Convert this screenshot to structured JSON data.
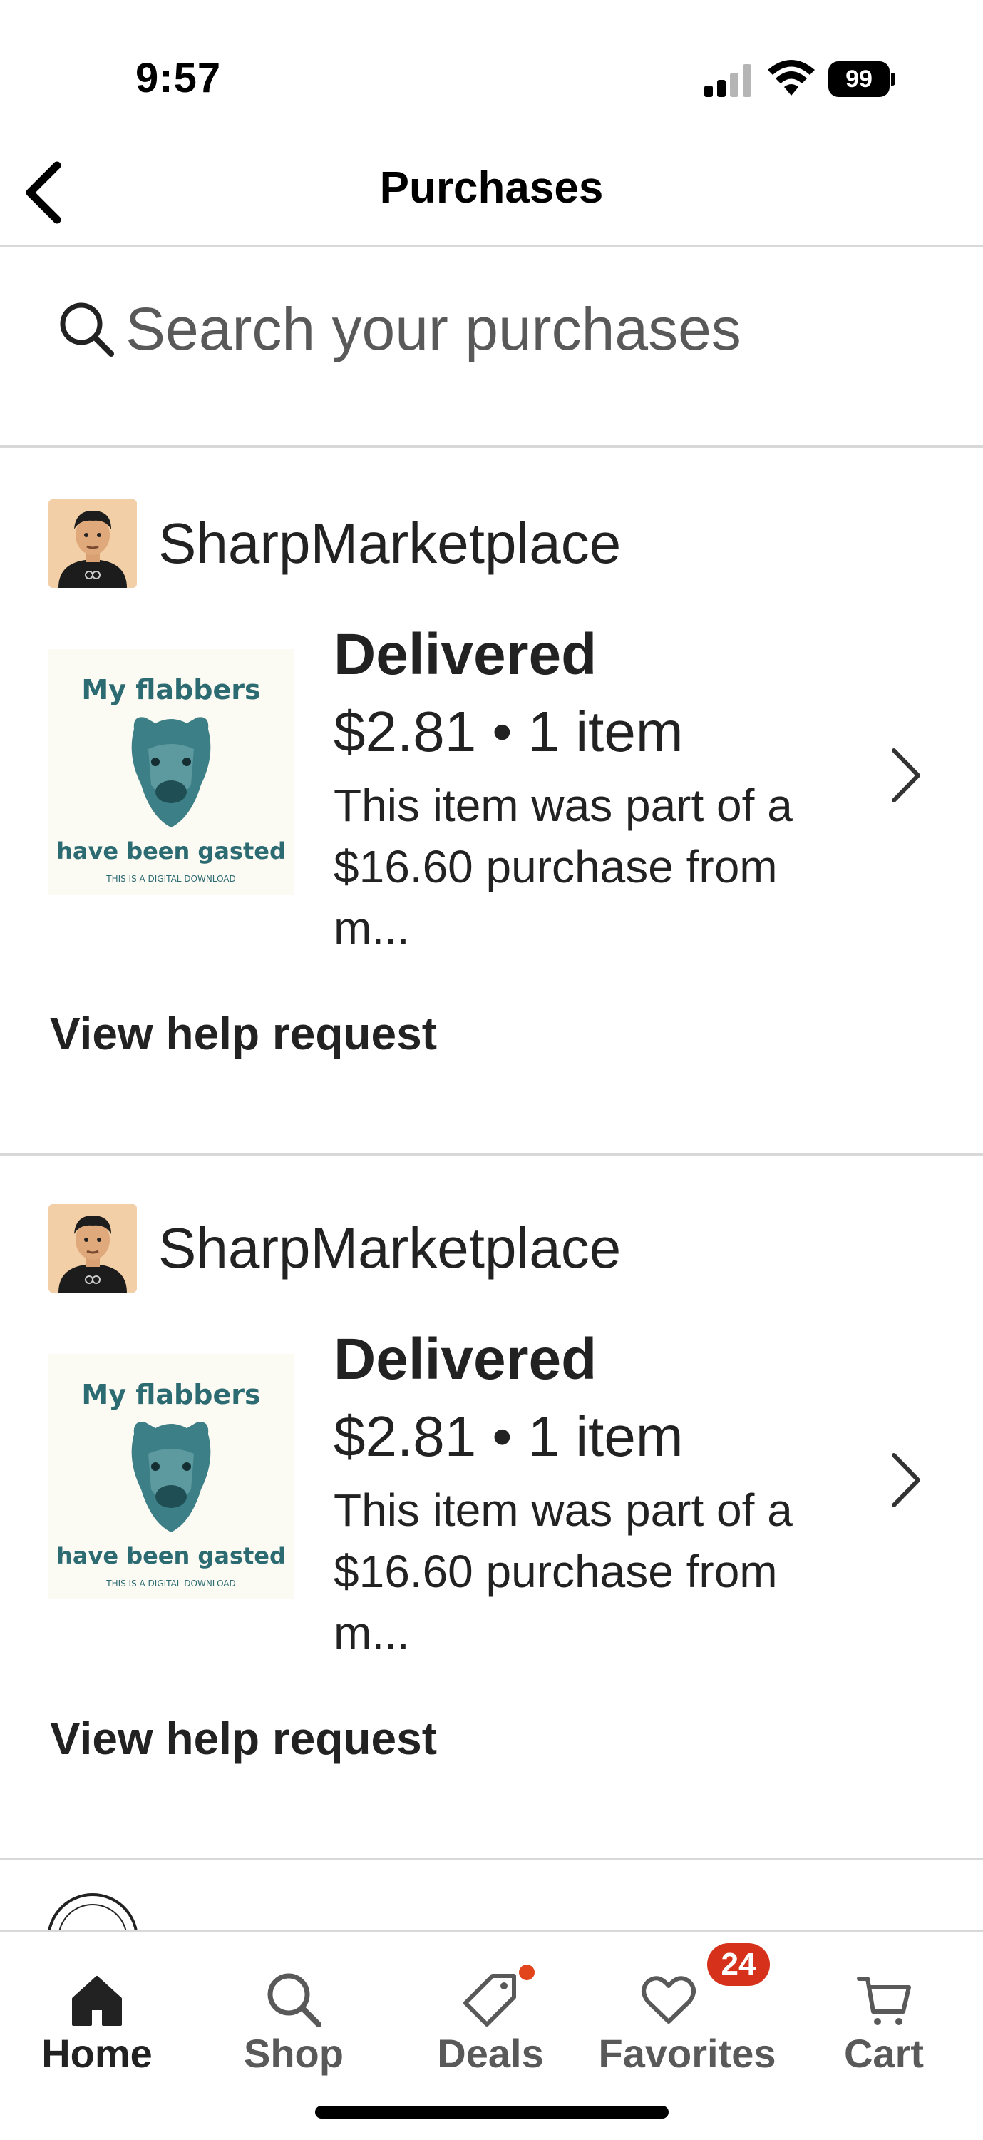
{
  "status_bar": {
    "time": "9:57",
    "battery": "99",
    "icons": [
      "signal-icon",
      "wifi-icon",
      "battery-icon"
    ]
  },
  "header": {
    "title": "Purchases",
    "back_icon": "chevron-left-icon"
  },
  "search": {
    "placeholder": "Search your purchases",
    "value": "",
    "icon": "search-icon"
  },
  "purchases": [
    {
      "shop_name": "SharpMarketplace",
      "status": "Delivered",
      "price_summary": "$2.81 • 1 item",
      "description": "This item was part of a $16.60 purchase from m...",
      "help_link": "View help request",
      "product_image_text": {
        "line1": "My flabbers",
        "line2": "have been gasted",
        "line3": "THIS IS A DIGITAL DOWNLOAD"
      }
    },
    {
      "shop_name": "SharpMarketplace",
      "status": "Delivered",
      "price_summary": "$2.81 • 1 item",
      "description": "This item was part of a $16.60 purchase from m...",
      "help_link": "View help request",
      "product_image_text": {
        "line1": "My flabbers",
        "line2": "have been gasted",
        "line3": "THIS IS A DIGITAL DOWNLOAD"
      }
    }
  ],
  "tabbar": {
    "tabs": [
      {
        "label": "Home",
        "icon": "home-icon",
        "active": true
      },
      {
        "label": "Shop",
        "icon": "search-icon",
        "active": false
      },
      {
        "label": "Deals",
        "icon": "tag-icon",
        "active": false
      },
      {
        "label": "Favorites",
        "icon": "heart-icon",
        "active": false,
        "badge": "24"
      },
      {
        "label": "Cart",
        "icon": "cart-icon",
        "active": false
      }
    ]
  },
  "colors": {
    "badge": "#d6321b",
    "deals_dot": "#e2441b",
    "design_teal": "#2d6b72",
    "divider": "#d8d8d8"
  }
}
